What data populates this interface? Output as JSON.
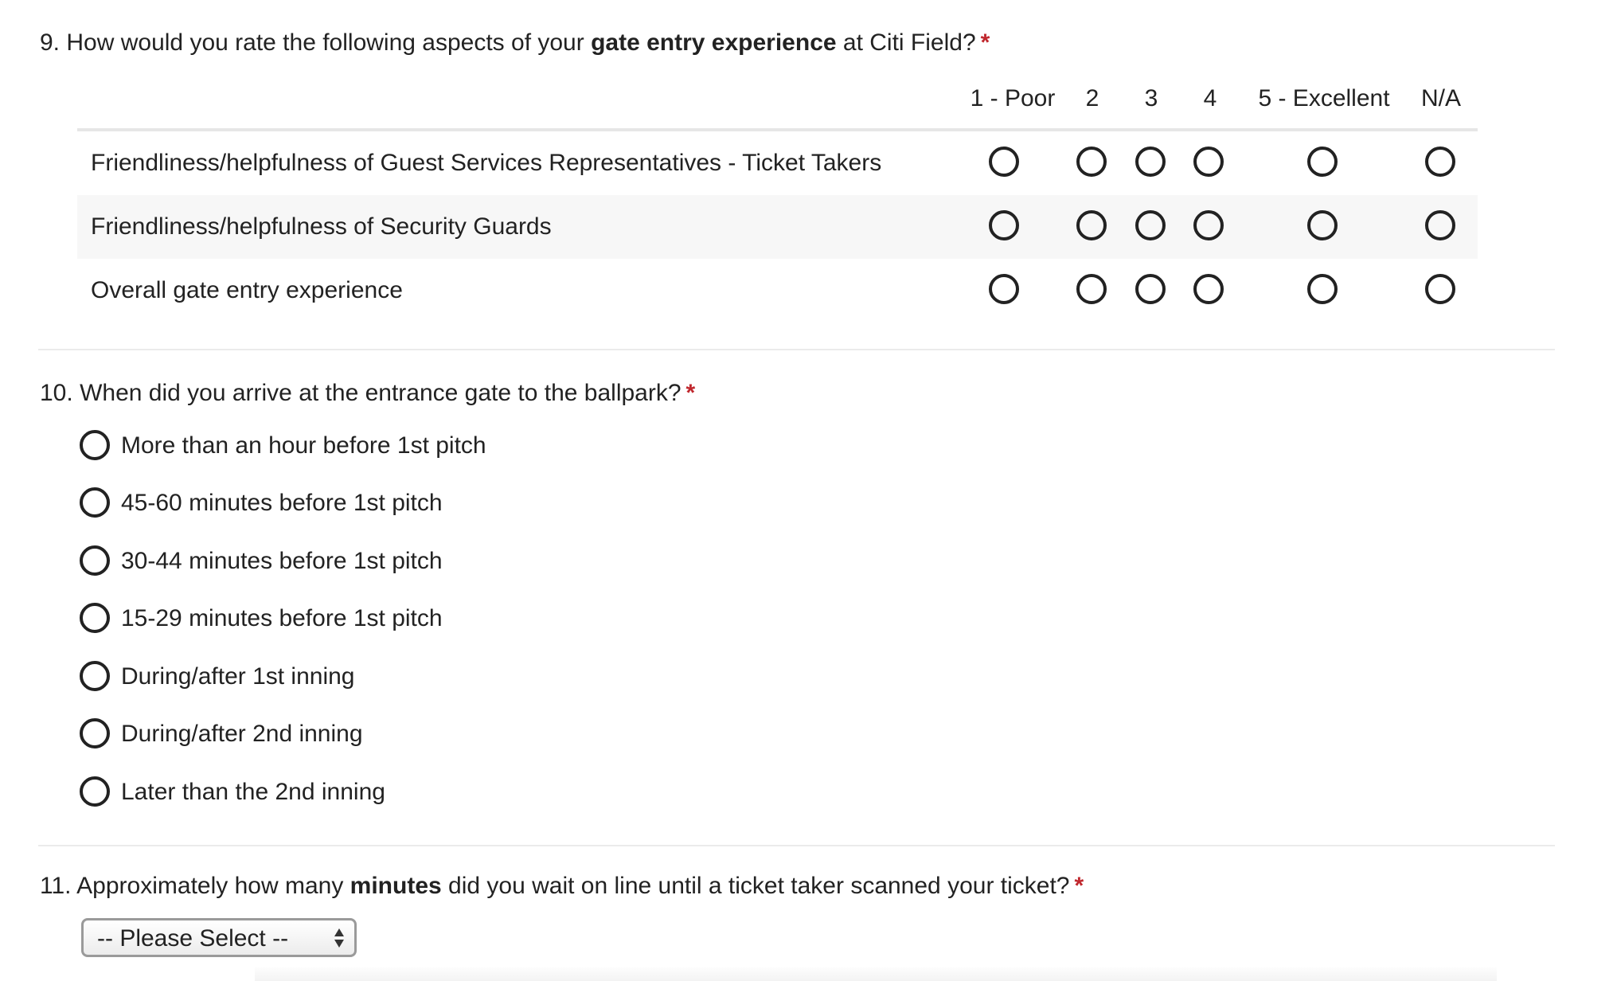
{
  "q9": {
    "number": "9.",
    "text_before": "How would you rate the following aspects of your",
    "text_bold": "gate entry experience",
    "text_after": "at Citi Field?",
    "required_mark": "*",
    "columns": [
      "1 - Poor",
      "2",
      "3",
      "4",
      "5 - Excellent",
      "N/A"
    ],
    "rows": [
      {
        "label": "Friendliness/helpfulness of Guest Services Representatives - Ticket Takers",
        "selected": null
      },
      {
        "label": "Friendliness/helpfulness of Security Guards",
        "selected": null
      },
      {
        "label": "Overall gate entry experience",
        "selected": null
      }
    ]
  },
  "q10": {
    "number": "10.",
    "text": "When did you arrive at the entrance gate to the ballpark?",
    "required_mark": "*",
    "options": [
      "More than an hour before 1st pitch",
      "45-60 minutes before 1st pitch",
      "30-44 minutes before 1st pitch",
      "15-29 minutes before 1st pitch",
      "During/after 1st inning",
      "During/after 2nd inning",
      "Later than the 2nd inning"
    ],
    "selected": null
  },
  "q11": {
    "number": "11.",
    "text_before": "Approximately how many",
    "text_bold": "minutes",
    "text_after": "did you wait on line until a ticket taker scanned your ticket?",
    "required_mark": "*",
    "select_value": "-- Please Select --",
    "select_icon": "updown-arrows-icon"
  },
  "colors": {
    "required": "#c0272d",
    "text": "#222222",
    "alt_row": "#f7f7f7",
    "divider": "#ebebeb"
  }
}
